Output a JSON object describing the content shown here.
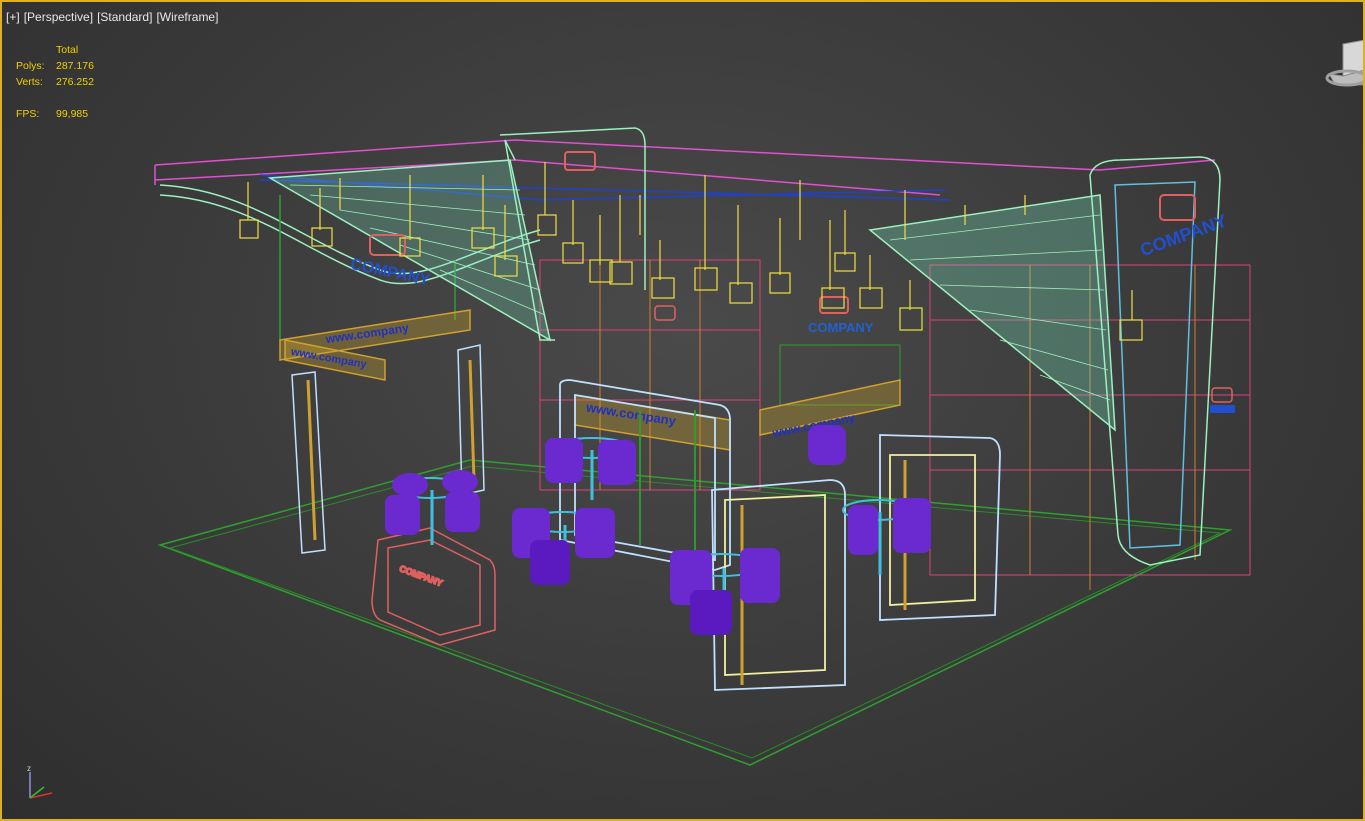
{
  "viewport": {
    "plus_label": "[+]",
    "view_label": "[Perspective]",
    "shading_style_label": "[Standard]",
    "render_mode_label": "[Wireframe]"
  },
  "stats": {
    "column_header": "Total",
    "polys_label": "Polys:",
    "polys_value": "287.176",
    "verts_label": "Verts:",
    "verts_value": "276.252",
    "fps_label": "FPS:",
    "fps_value": "99,985"
  },
  "scene": {
    "logo_text": "COMPANY",
    "banner_text": "www.company",
    "banner_text_reversed": "www.company"
  },
  "colors": {
    "frame": "#e0b020",
    "stats_text": "#f0d000",
    "floor": "#2ea02e",
    "frame_magenta": "#e0407a",
    "frame_cyan": "#9ef0c0",
    "frame_blue": "#2040d0",
    "lamps": "#f0e040",
    "chairs": "#6a2ad0",
    "panels": "#c0e0ff",
    "counter": "#e06060"
  }
}
